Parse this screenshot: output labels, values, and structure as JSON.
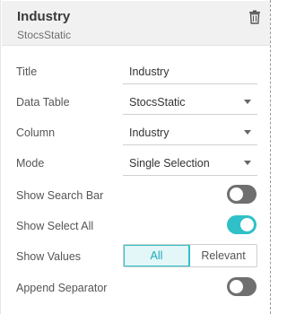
{
  "header": {
    "title": "Industry",
    "subtitle": "StocsStatic",
    "delete_icon": "trash-icon"
  },
  "fields": {
    "title": {
      "label": "Title",
      "value": "Industry"
    },
    "data_table": {
      "label": "Data Table",
      "value": "StocsStatic"
    },
    "column": {
      "label": "Column",
      "value": "Industry"
    },
    "mode": {
      "label": "Mode",
      "value": "Single Selection"
    },
    "show_search_bar": {
      "label": "Show Search Bar",
      "enabled": false
    },
    "show_select_all": {
      "label": "Show Select All",
      "enabled": true
    },
    "show_values": {
      "label": "Show Values",
      "options": [
        "All",
        "Relevant"
      ],
      "selected": "All"
    },
    "append_separator": {
      "label": "Append Separator",
      "enabled": false
    }
  },
  "colors": {
    "accent": "#2fc1c7",
    "toggle_off": "#6f6f6f",
    "header_bg": "#f1f1f1"
  }
}
